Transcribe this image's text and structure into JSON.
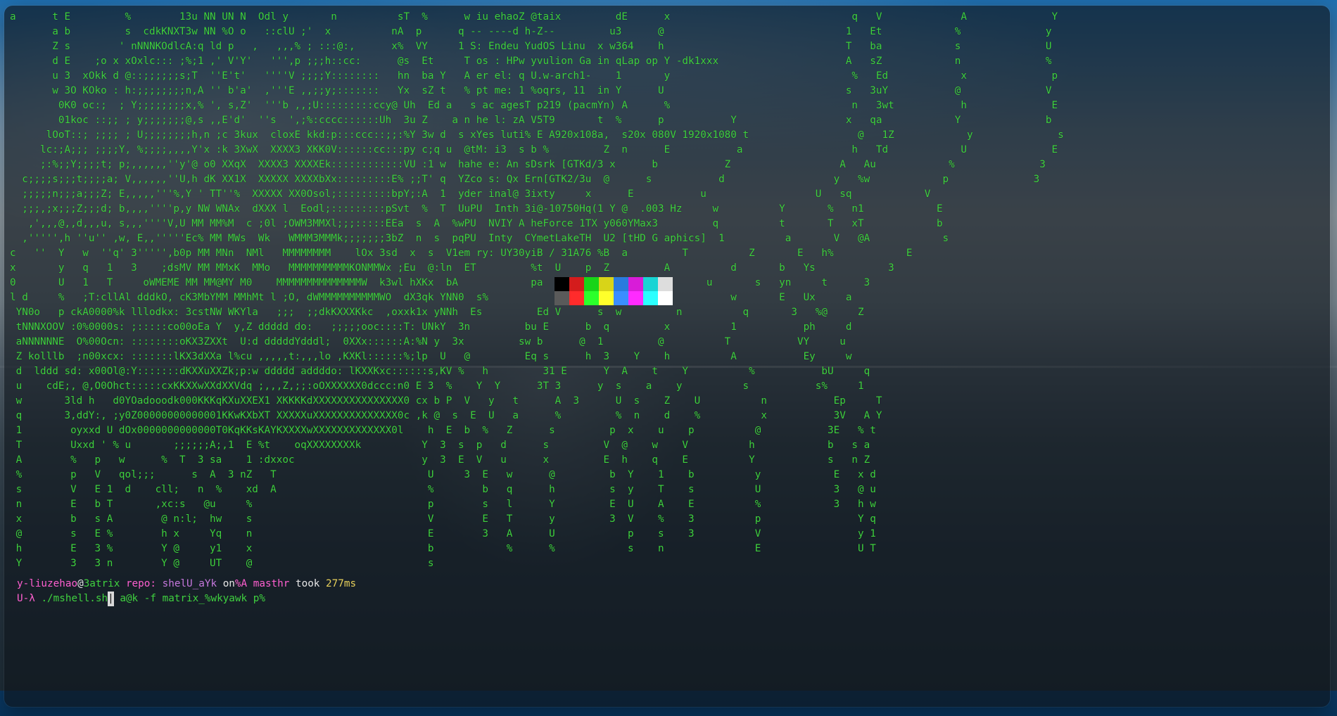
{
  "prompt": {
    "user": "y-liuzehao",
    "at": "@",
    "host": "3atrix",
    "repo_label": "repo:",
    "repo_name": "shelU_aYk",
    "on": "on",
    "branch": "%A masthr",
    "took": "took",
    "duration": "277ms",
    "symbol": "U-λ",
    "command": "./mshell.sh",
    "command_rest": "a@k -f matrix_%wkyawk p%"
  },
  "neofetch": {
    "title": "ehaoZ @taix",
    "underline": "h-Z--",
    "info": [
      {
        "key": "S: Endeu",
        "value": "YudOS Linu  x w364"
      },
      {
        "key": "os : HPw",
        "value": "yvulion Ga in qLap op Y -dk1xxx"
      },
      {
        "key": "er el: q",
        "value": "U.w-arch1-"
      },
      {
        "key": "pt me: 1",
        "value": "%oqrs, 11  in"
      },
      {
        "key": "ac agesT",
        "value": "p219 (pacmYn)"
      },
      {
        "key": "n he l: zA",
        "value": "V5T9"
      },
      {
        "key": "luti% E",
        "value": "A920x108a,  s20x 080V 1920x1080"
      },
      {
        "key": "tM: i3  s",
        "value": "b %"
      },
      {
        "key": "hahe e: An",
        "value": "sDsrk [GTKd/3"
      },
      {
        "key": "s: Qx",
        "value": "Ern[GTK2/3u"
      },
      {
        "key": "inal@",
        "value": "3ixty"
      },
      {
        "key": "Inth",
        "value": "3i@-10750Hq(1 Y @ .003 Hz"
      },
      {
        "key": "NVIY",
        "value": "A heForce 1TX y060YMax3"
      },
      {
        "key": "Inty",
        "value": "CYmetLakeTH  U2 [tHD G aphics]"
      },
      {
        "key": "ry:",
        "value": "UY30yiB / 31A76 %B"
      }
    ]
  },
  "palette": [
    "#000000",
    "#d41c1c",
    "#18d418",
    "#d8d418",
    "#2a7bde",
    "#d81cd8",
    "#18d4d4",
    "#dddddd",
    "#5a5a5a",
    "#ff2b2b",
    "#2bff2b",
    "#ffff2b",
    "#3b8eff",
    "#ff2bff",
    "#2bffff",
    "#ffffff"
  ],
  "terminal": {
    "lines": [
      "a      t E         %        13u NN UN N  Odl y       n          sT  %      w iu ehaoZ @taix         dE      x                              q   V             A              Y",
      "       a b         s  cdkKNXT3w NN %O o   ::clU ;'  x          nA  p      q -- ----d h-Z--         u3      @                              1   Et            %              y",
      "       Z s        ' nNNNKOdlcA:q ld p   ,   ,,,% ; :::@:,      x%  VY     1 S: Endeu YudOS Linu  x w364    h                              T   ba            s              U",
      "       d E    ;o x xOxlc::: ;%;1 ,' V'Y'   ''',p ;;;h::cc:      @s  Et     T os : HPw yvulion Ga in qLap op Y -dk1xxx                     A   sZ            n              %",
      "       u 3  xOkk d @::;;;;;;s;T  ''E't'   ''''V ;;;;Y::::::::   hn  ba Y   A er el: q U.w-arch1-    1       y                              %   Ed            x              p",
      "       w 3O KOko : h:;;;;;;;;n,A '' b'a'  ,'''E ,,;;y;:::::::   Yx  sZ t   % pt me: 1 %oqrs, 11  in Y      U                              s   3uY           @              V",
      "        0K0 oc:;  ; Y;;;;;;;;x,% ', s,Z'  '''b ,,;U:::::::::ccy@ Uh  Ed a   s ac agesT p219 (pacmYn) A      %                              n   3wt           h              E",
      "        01koc ::;; ; y;;;;;;;@,s ,,E'd'  ''s  ',;%:cccc::::::Uh  3u Z    a n he l: zA V5T9       t  %      p           Y                  x   qa            Y              b",
      "      lOoT::; ;;;; ; U;;;;;;;;h,n ;c 3kux  cloxE kkd:p:::ccc::;;:%Y 3w d  s xYes luti% E A920x108a,  s20x 080V 1920x1080 t                  @   1Z            y              s",
      "     lc:;A;;; ;;;;Y, %;;;;,,,,Y'x :k 3XwX  XXXX3 XKK0V::::::cc:::py c;q u  @tM: i3  s b %         Z  n      E           a                  h   Td            U              E",
      "     ;:%;;Y;;;;t; p;,,,,,,''y'@ o0 XXqX  XXXX3 XXXXEk::::::::::::VU :1 w  hahe e: An sDsrk [GTKd/3 x      b           Z                  A   Au            %              3",
      "  c;;;;s;;;t;;;;a; V,,,,,,''U,h dK XX1X  XXXXX XXXXbXx:::::::::E% ;;T' q  YZco s: Qx Ern[GTK2/3u  @      s           d                  y   %w            p              3",
      "  ;;;;;n;;;a;;;Z; E,,,,,'''%,Y ' TT''%  XXXXX XX0Osol;:::::::::bpY;:A  1  yder inal@ 3ixty     x      E           u                  U   sq            V",
      "  ;;;,;x;;;Z;;;d; b,,,,''''p,y NW WNAx  dXXX l  Eodl;:::::::::pSvt  %  T  UuPU  Inth 3i@-10750Hq(1 Y @  .003 Hz     w          Y       %   n1            E",
      "   ,',,,@,,d,,,u, s,,,''''V,U MM MM%M  c ;0l ;OWM3MMXl;;;:::::EEa  s  A  %wPU  NVIY A heForce 1TX y060YMax3         q          t       T   xT            b",
      "  ,''''',h ''u'' ,w, E,,'''''Ec% MM MWs  Wk   WMMM3MMMk;;;;;;;3bZ  n  s  pqPU  Inty  CYmetLakeTH  U2 [tHD G aphics]  1          a       V   @A            s",
      "c   ''  Y   w  ''q' 3''''',b0p MM MNn  NMl   MMMMMMMM    lOx 3sd  x  s  V1em ry: UY30yiB / 31A76 %B  a         T          Z       E   h%            E",
      "x       y   q   1   3    ;dsMV MM MMxK  MMo   MMMMMMMMMMKONMMWx ;Eu  @:ln  ET         %t  U    p  Z         A          d       b   Ys            3",
      "0       U   1   T     oWMEME MM MM@MY M0    MMMMMMMMMMMMMMW  k3wl hXKx  bA            pa   V  d         %          u       s   yn     t      3",
      "l d     %   ;T:cllAl dddkO, cK3MbYMM MMhMt l ;O, dWMMMMMMMMMMWO  dX3qk YNN0  s%           VZ   E  u         s          w       E   Ux     a",
      " YN0o   p ckA0000%k lllodkx: 3cstNW WKYla   ;;;  ;;dkKXXXKkc  ,oxxk1x yNNh  Es         Ed V      s  w         n          q       3   %@     Z",
      " tNNNXOOV :0%0000s: ;:::::co00oEa Y  y,Z ddddd do:   ;;;;;ooc::::T: UNkY  3n         bu E      b  q         x          1           ph     d",
      " aNNNNNNE  O%00Ocn: ::::::::oKX3ZXXt  U:d dddddYdddl;  0XXx::::::A:%N y  3x         sw b      @  1         @          T           VY     u",
      " Z kolllb  ;n00xcx: :::::::lKX3dXXa l%cu ,,,,,t:,,,lo ,KXKl::::::%;lp  U   @         Eq s      h  3    Y    h          A           Ey     w",
      " d  lddd sd: x00Ol@:Y:::::::dKXXuXXZk;p:w ddddd addddo: lKXXKxc::::::s,KV %   h         31 E      Y  A    t    Y          %           bU     q",
      " u    cdE;, @,O0Ohct:::::cxKKXXwXXdXXVdq ;,,,Z,;;:oOXXXXXX0dccc:n0 E 3  %    Y  Y      3T 3      y  s    a    y          s           s%     1",
      " w       3ld h   d0YOadooodk000KKKqKXuXXEX1 XKKKKdXXXXXXXXXXXXXXX0 cx b P  V   y   t      A  3      U  s    Z    U          n           Ep     T",
      " q       3,ddY:, ;y0Z00000000000001KKwKXbXT XXXXXuXXXXXXXXXXXXXX0c ,k @  s  E  U   a      %         %  n    d    %          x           3V   A Y",
      " 1        oyxxd U dOx0000000000000T0KqKKsKAYKXXXXwXXXXXXXXXXXXX0l    h  E  b  %   Z      s         p  x    u    p          @           3E   % t",
      " T        Uxxd ' % u       ;;;;;;A;,1  E %t    oqXXXXXXXXk          Y  3  s  p   d      s         V  @    w    V          h            b   s a",
      " A        %   p   w      %  T  3 sa    1 :dxxoc                     y  3  E  V   u      x         E  h    q    E          Y            s   n Z",
      " %        p   V   qol;;;      s  A  3 nZ   T                         U     3  E   w      @         b  Y    1    b          y            E   x d",
      " s        V   E 1  d    cll;   n  %    xd  A                         %        b   q      h         s  y    T    s          U            3   @ u",
      " n        E   b T       ,xc:s   @u     %                             p        s   l      Y         E  U    A    E          %            3   h w",
      " x        b   s A        @ n:l;  hw    s                             V        E   T      y         3  V    %    3          p                Y q",
      " @        s   E %        h x     Yq    n                             E        3   A      U            p    s    3          V                y 1",
      " h        E   3 %        Y @     y1    x                             b            %      %            s    n               E                U T",
      " Y        3   3 n        Y @     UT    @                             s                                                                        "
    ]
  }
}
